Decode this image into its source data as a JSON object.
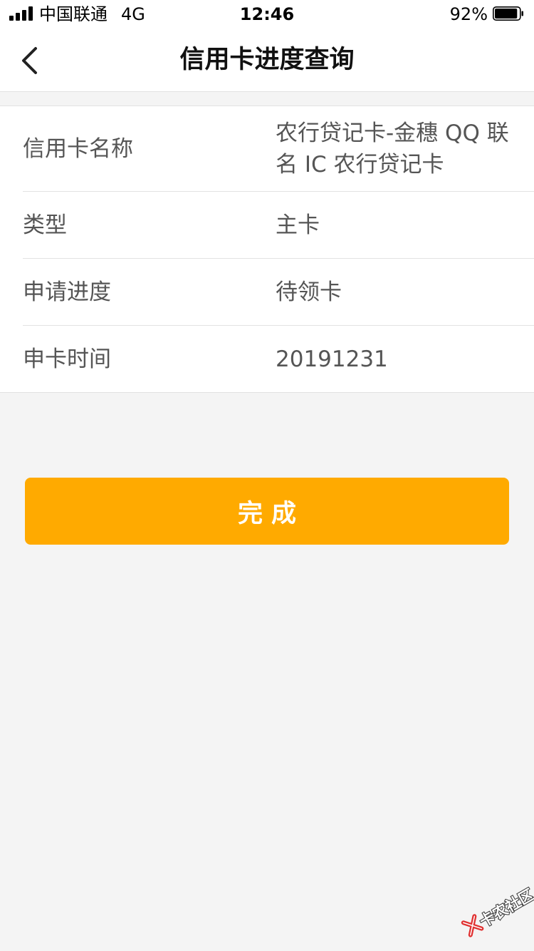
{
  "status_bar": {
    "carrier": "中国联通",
    "network": "4G",
    "time": "12:46",
    "battery_percent": "92%",
    "battery_level": 0.92
  },
  "nav": {
    "title": "信用卡进度查询"
  },
  "info": {
    "rows": [
      {
        "label": "信用卡名称",
        "value": "农行贷记卡-金穗 QQ 联名 IC 农行贷记卡"
      },
      {
        "label": "类型",
        "value": "主卡"
      },
      {
        "label": "申请进度",
        "value": "待领卡"
      },
      {
        "label": "申卡时间",
        "value": "20191231"
      }
    ]
  },
  "actions": {
    "done_label": "完成"
  },
  "watermark": {
    "text": "卡农社区"
  },
  "colors": {
    "accent": "#ffaa00",
    "page_background": "#f4f4f4",
    "card_background": "#ffffff",
    "text_secondary": "#555555",
    "divider": "#e2e2e2"
  },
  "icons": {
    "back": "chevron-left-icon",
    "signal": "signal-icon",
    "battery": "battery-icon"
  }
}
